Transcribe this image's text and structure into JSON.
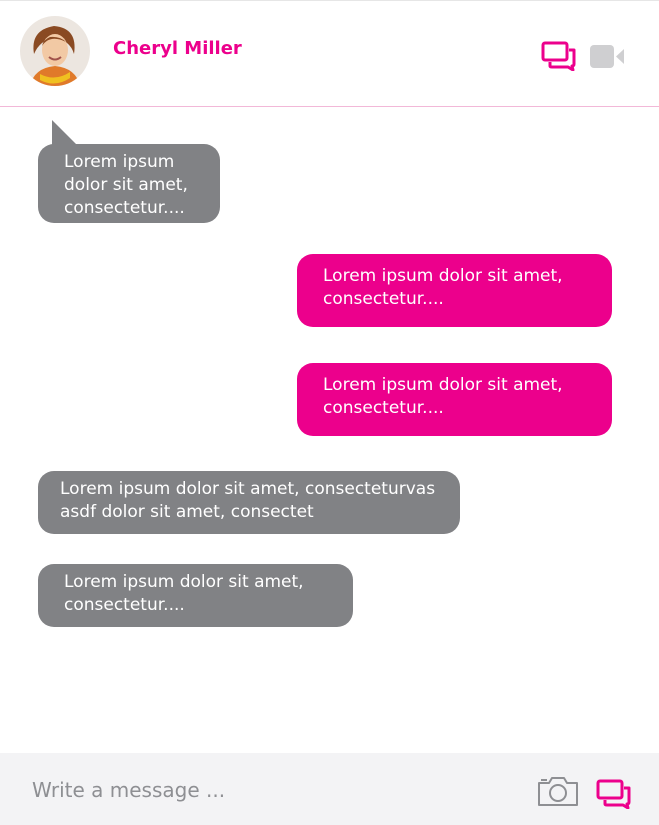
{
  "header": {
    "contact_name": "Cheryl Miller",
    "icons": {
      "messages": "chat-bubbles-icon",
      "video": "video-camera-icon"
    }
  },
  "messages": [
    {
      "direction": "incoming",
      "text": "Lorem ipsum\ndolor sit amet,\nconsectetur...."
    },
    {
      "direction": "outgoing",
      "text": "Lorem ipsum dolor sit amet,\nconsectetur...."
    },
    {
      "direction": "outgoing",
      "text": "Lorem ipsum dolor sit amet,\nconsectetur...."
    },
    {
      "direction": "incoming",
      "text": "Lorem ipsum  dolor sit amet, consecteturvas\nasdf  dolor sit amet, consectet"
    },
    {
      "direction": "incoming",
      "text": "Lorem ipsum  dolor sit amet,\nconsectetur...."
    }
  ],
  "composer": {
    "placeholder": "Write a message ...",
    "icons": {
      "camera": "camera-icon",
      "send": "chat-bubbles-icon"
    }
  },
  "colors": {
    "accent": "#ec008c",
    "incoming_bubble": "#818285",
    "muted_icon": "#cfcfd1",
    "composer_bg": "#f3f3f5"
  }
}
